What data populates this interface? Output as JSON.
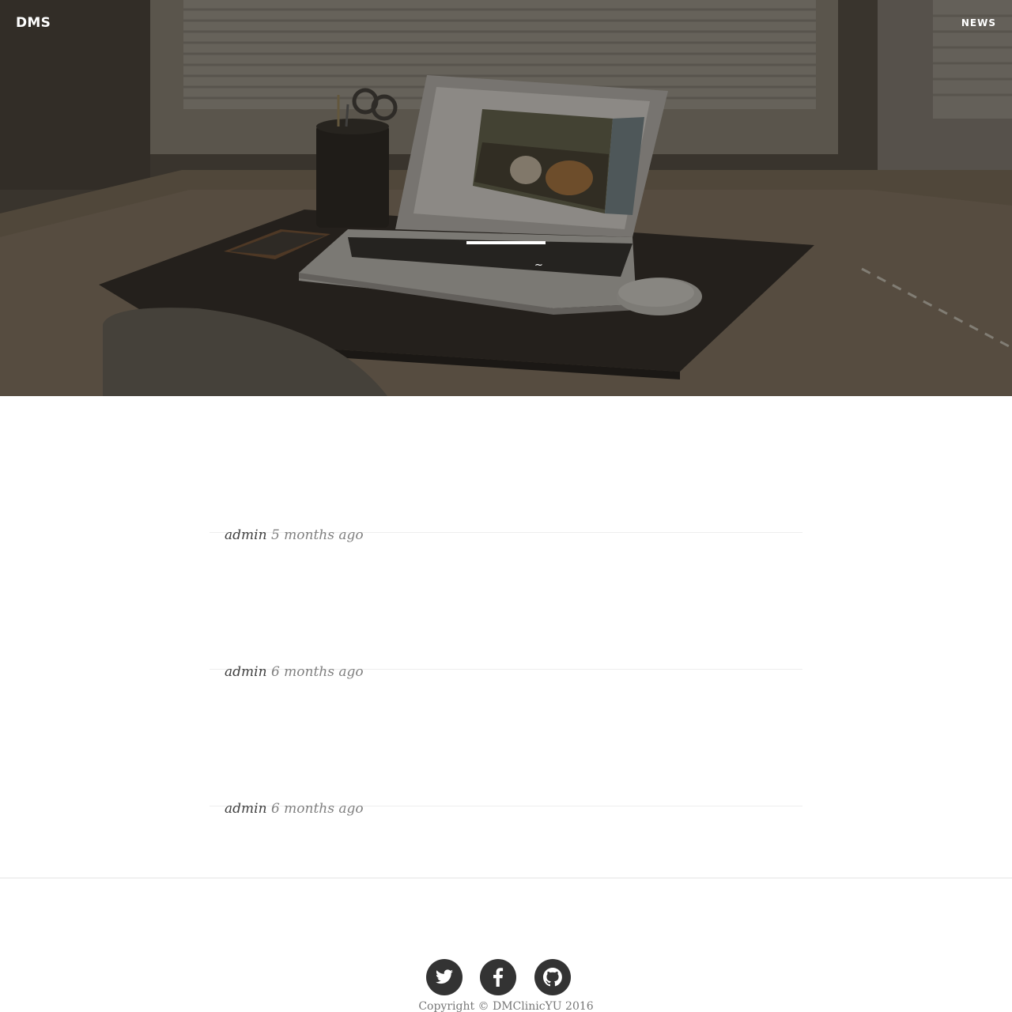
{
  "navbar": {
    "brand": "DMS",
    "links": [
      {
        "label": "NEWS"
      }
    ]
  },
  "hero": {
    "image": "desk-with-laptop-photo",
    "subheading": "~"
  },
  "posts": [
    {
      "title": "",
      "author": "admin",
      "time": "5 months ago"
    },
    {
      "title": "",
      "author": "admin",
      "time": "6 months ago"
    },
    {
      "title": "",
      "author": "admin",
      "time": "6 months ago"
    }
  ],
  "footer": {
    "social": [
      {
        "name": "Twitter",
        "icon": "twitter-icon"
      },
      {
        "name": "Facebook",
        "icon": "facebook-icon"
      },
      {
        "name": "GitHub",
        "icon": "github-icon"
      }
    ],
    "copyright": "Copyright © DMClinicYU 2016"
  },
  "colors": {
    "hero_overlay": "#2b2620",
    "meta_text": "#808080",
    "author_text": "#404040",
    "social_circle": "#333333",
    "divider": "#eeeeee"
  }
}
